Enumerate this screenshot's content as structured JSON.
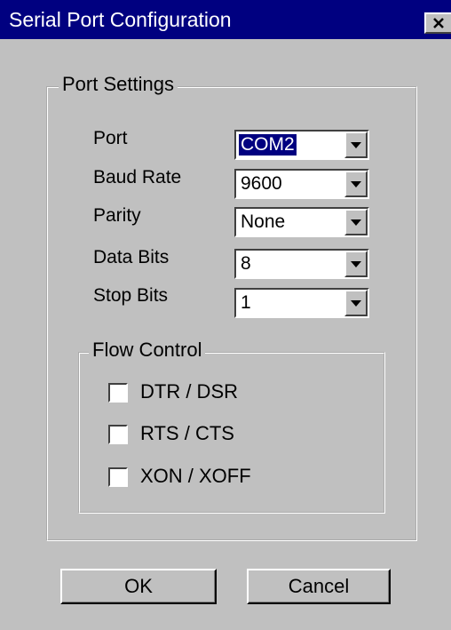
{
  "window": {
    "title": "Serial Port Configuration",
    "close_icon": "close-icon"
  },
  "port_settings": {
    "legend": "Port Settings",
    "fields": [
      {
        "label": "Port",
        "value": "COM2",
        "selected": true
      },
      {
        "label": "Baud Rate",
        "value": "9600"
      },
      {
        "label": "Parity",
        "value": "None"
      },
      {
        "label": "Data Bits",
        "value": "8"
      },
      {
        "label": "Stop Bits",
        "value": "1"
      }
    ],
    "dropdown_icon": "chevron-down-icon"
  },
  "flow_control": {
    "legend": "Flow Control",
    "options": [
      {
        "label": "DTR / DSR",
        "checked": false
      },
      {
        "label": "RTS / CTS",
        "checked": false
      },
      {
        "label": "XON / XOFF",
        "checked": false
      }
    ]
  },
  "buttons": {
    "ok_label": "OK",
    "cancel_label": "Cancel"
  },
  "colors": {
    "title_bar": "#000080",
    "face": "#c0c0c0",
    "selection": "#000080"
  }
}
